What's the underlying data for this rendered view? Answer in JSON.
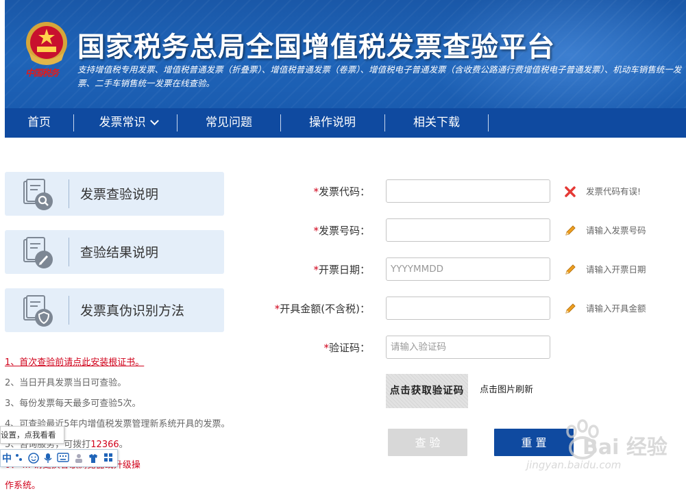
{
  "header": {
    "logo_text": "中国税务",
    "title": "国家税务总局全国增值税发票查验平台",
    "subtitle": "支持增值税专用发票、增值税普通发票（折叠票）、增值税普通发票（卷票）、增值税电子普通发票（含收费公路通行费增值税电子普通发票）、机动车销售统一发票、二手车销售统一发票在线查验。"
  },
  "nav": {
    "items": [
      {
        "label": "首页"
      },
      {
        "label": "发票常识"
      },
      {
        "label": "常见问题"
      },
      {
        "label": "操作说明"
      },
      {
        "label": "相关下载"
      }
    ]
  },
  "help_cards": [
    {
      "label": "发票查验说明",
      "icon": "search-doc-icon"
    },
    {
      "label": "查验结果说明",
      "icon": "edit-doc-icon"
    },
    {
      "label": "发票真伪识别方法",
      "icon": "shield-doc-icon"
    }
  ],
  "notes": {
    "n1": "1、首次查验前请点此安装根证书。",
    "n2": "2、当日开具发票当日可查验。",
    "n3": "3、每份发票每天最多可查验5次。",
    "n4": "4、可查验最近5年内增值税发票管理新系统开具的发票。",
    "n5_prefix": "5、咨询服务，可拨打",
    "n5_phone": "12366",
    "n5_suffix": "。",
    "n6a": "6、 ... 请更换谷歌浏览器或升级操",
    "n6b": "作系统。"
  },
  "ime": {
    "tip": "设置，点我看看",
    "lang": "中"
  },
  "form": {
    "invoice_code": {
      "label": "发票代码：",
      "value": "",
      "hint": "发票代码有误!"
    },
    "invoice_number": {
      "label": "发票号码：",
      "value": "",
      "hint": "请输入发票号码"
    },
    "issue_date": {
      "label": "开票日期：",
      "placeholder": "YYYYMMDD",
      "hint": "请输入开票日期"
    },
    "amount": {
      "label": "开具金额(不含税)：",
      "value": "",
      "hint": "请输入开具金额"
    },
    "captcha": {
      "label": "验证码：",
      "placeholder": "请输入验证码"
    },
    "required_mark": "*",
    "captcha_image_text": "点击获取验证码",
    "refresh_text": "点击图片刷新",
    "query_button": "查 验",
    "reset_button": "重 置"
  },
  "watermark": {
    "text": "Bai 经验",
    "url": "jingyan.baidu.com"
  },
  "colors": {
    "brand_blue": "#0f4aa0",
    "error_red": "#d0021b",
    "card_bg": "#e4eef9"
  }
}
